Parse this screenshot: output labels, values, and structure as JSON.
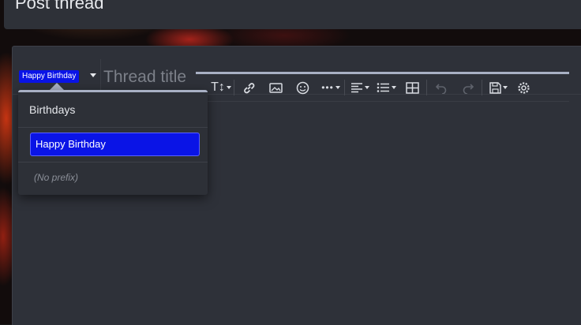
{
  "page": {
    "title": "Post thread"
  },
  "thread": {
    "prefix_label": "Happy Birthday",
    "title_placeholder": "Thread title",
    "title_value": ""
  },
  "prefix_menu": {
    "group_label": "Birthdays",
    "selected_option": "Happy Birthday",
    "none_option": "(No prefix)"
  },
  "toolbar": {
    "buttons": [
      {
        "name": "text-size-icon",
        "glyph": "T↕",
        "dropdown": true
      },
      {
        "name": "link-icon",
        "glyph": "🔗",
        "dropdown": false
      },
      {
        "name": "image-icon",
        "glyph": "🖼",
        "dropdown": false
      },
      {
        "name": "smilie-icon",
        "glyph": "☺",
        "dropdown": false
      },
      {
        "name": "more-options-icon",
        "glyph": "•••",
        "dropdown": true
      },
      {
        "name": "align-icon",
        "glyph": "☰",
        "dropdown": true
      },
      {
        "name": "list-icon",
        "glyph": "☷",
        "dropdown": true
      },
      {
        "name": "table-icon",
        "glyph": "⊞",
        "dropdown": false
      },
      {
        "name": "undo-icon",
        "glyph": "↶",
        "dropdown": false
      },
      {
        "name": "redo-icon",
        "glyph": "↷",
        "dropdown": false
      },
      {
        "name": "drafts-icon",
        "glyph": "💾",
        "dropdown": true
      },
      {
        "name": "settings-icon",
        "glyph": "⚙",
        "dropdown": false
      }
    ]
  },
  "colors": {
    "prefix_blue": "#0a14e6",
    "panel_bg": "#2e3139",
    "accent": "#a8b0c4"
  }
}
